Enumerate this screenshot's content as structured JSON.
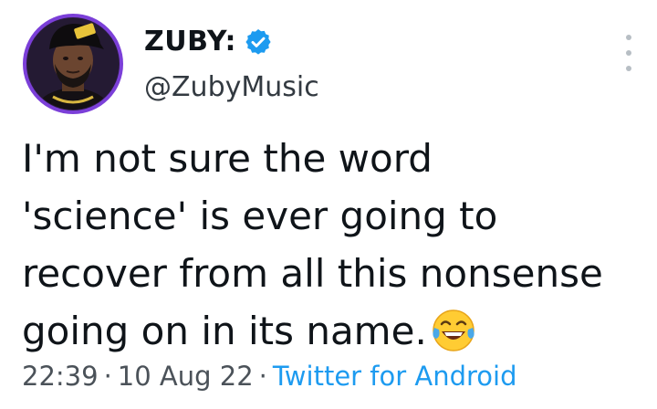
{
  "tweet": {
    "author": {
      "display_name": "ZUBY:",
      "handle": "@ZubyMusic",
      "verified": true,
      "avatar_icon": "profile-photo"
    },
    "text_lines": [
      "I'm not sure the word",
      "'science' is ever going to",
      "recover from all this nonsense",
      "going on in its name."
    ],
    "emoji": "face-with-tears-of-joy",
    "time": "22:39",
    "separator": "·",
    "date": "10 Aug 22",
    "source": "Twitter for Android"
  },
  "colors": {
    "text": "#0f1419",
    "muted": "#4b5259",
    "link": "#1d9bf0",
    "verified": "#1d9bf0",
    "avatar_ring": "#7b3fd8"
  }
}
